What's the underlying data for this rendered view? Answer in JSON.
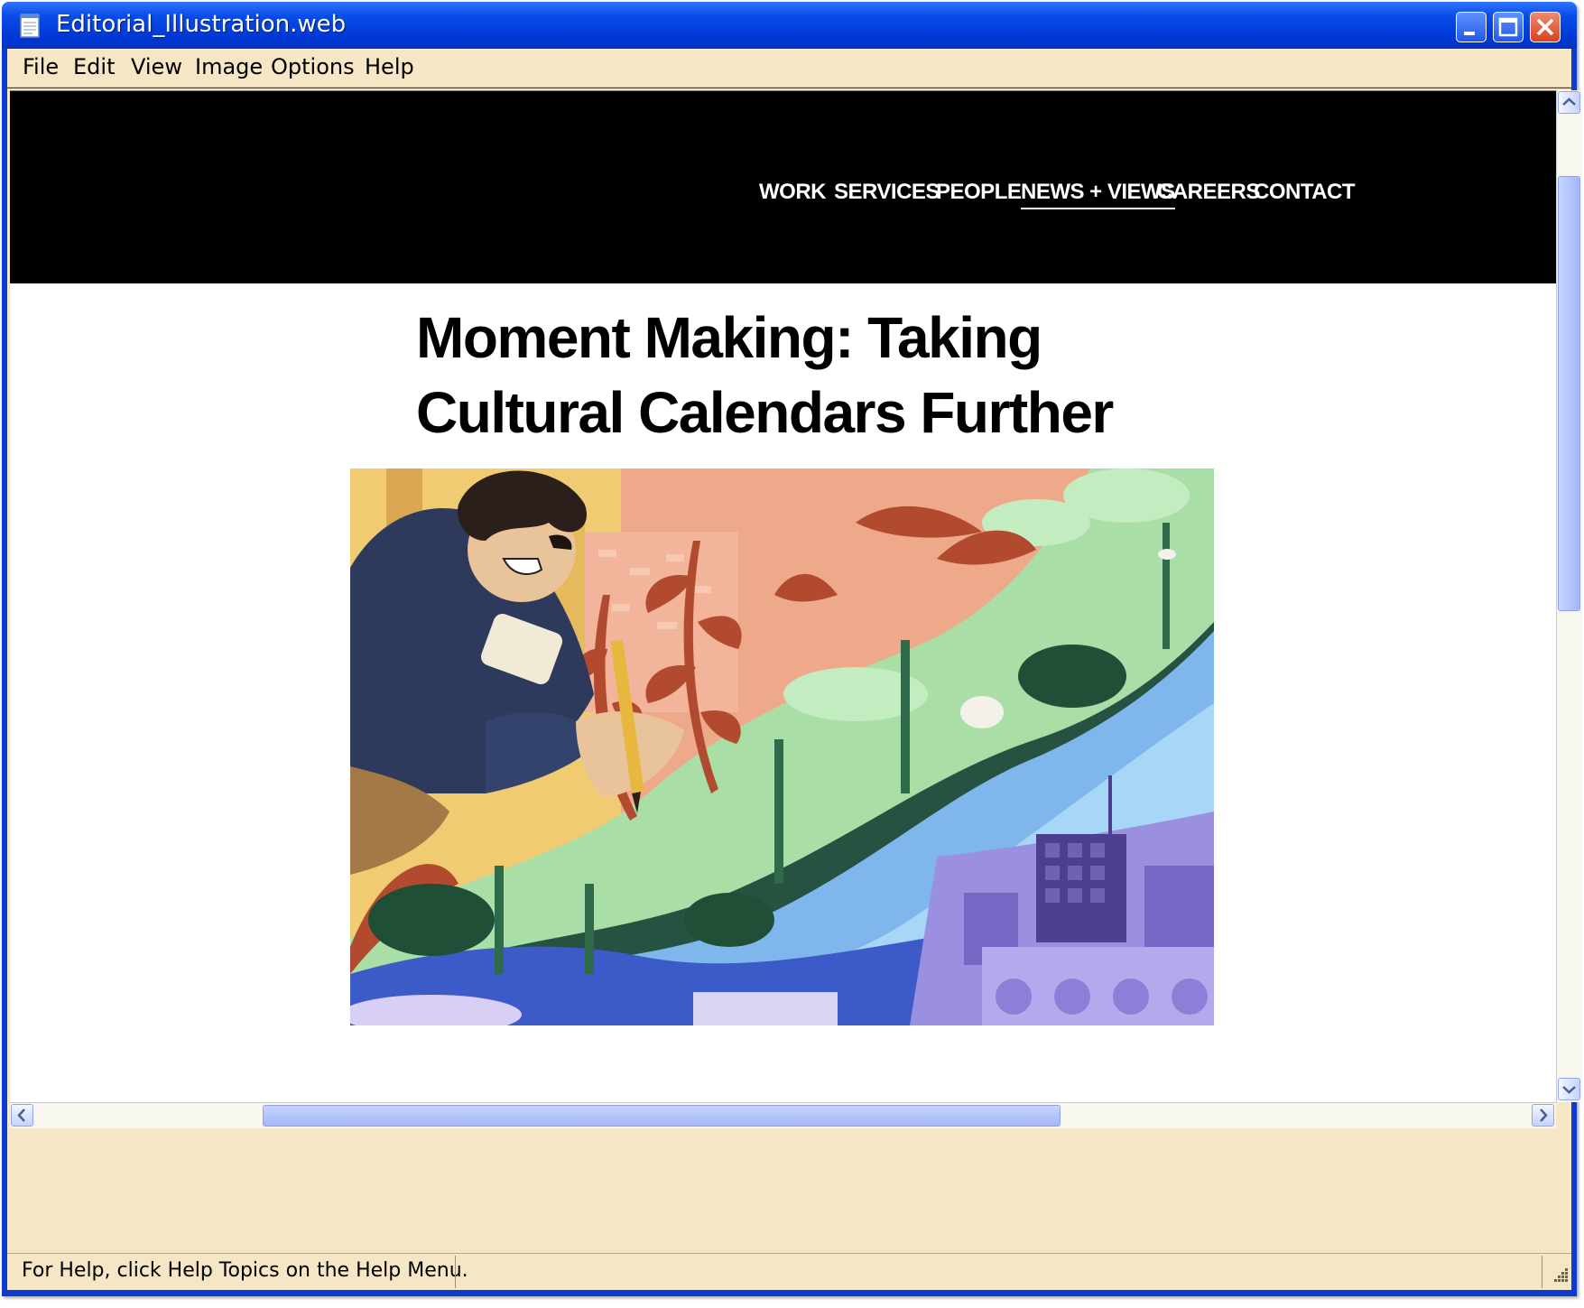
{
  "window": {
    "title": "Editorial_Illustration.web"
  },
  "menu": {
    "items": [
      "File",
      "Edit",
      "View",
      "Image",
      "Options",
      "Help"
    ]
  },
  "site": {
    "nav": [
      "WORK",
      "SERVICES",
      "PEOPLE",
      "NEWS + VIEWS",
      "CAREERS",
      "CONTACT"
    ],
    "active_nav": "NEWS + VIEWS"
  },
  "article": {
    "title": "Moment Making: Taking Cultural Calendars Further"
  },
  "status": {
    "text": "For Help, click Help Topics on the Help Menu."
  },
  "colors": {
    "titlebar": "#0038d6",
    "menubar": "#f5e6c6",
    "site_header": "#000000",
    "scroll_thumb": "#a3b6f8"
  },
  "icons": [
    "app-notepad-icon",
    "minimize-icon",
    "maximize-icon",
    "close-icon",
    "scroll-up-arrow-icon",
    "scroll-down-arrow-icon",
    "scroll-left-arrow-icon",
    "scroll-right-arrow-icon",
    "size-grip-icon"
  ]
}
